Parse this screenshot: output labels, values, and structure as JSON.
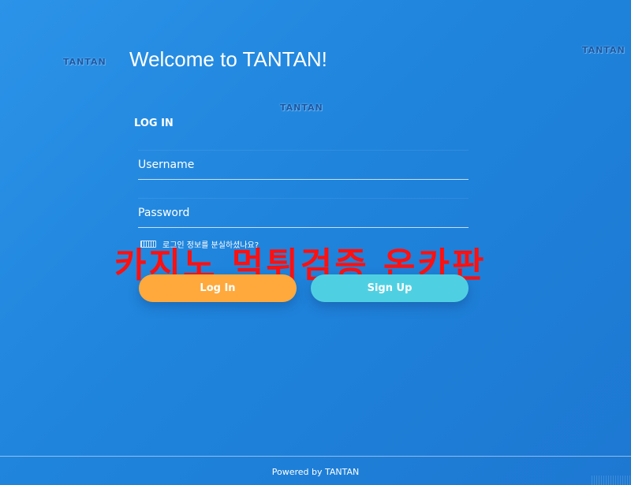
{
  "watermarks": [
    "TANTAN",
    "TANTAN",
    "TANTAN"
  ],
  "header": {
    "welcome_title": "Welcome to TANTAN!"
  },
  "login": {
    "heading": "LOG IN",
    "username_placeholder": "Username",
    "password_placeholder": "Password",
    "forgot_text": "로그인 정보를 분실하셨나요?",
    "forgot_icon": "keyboard-icon",
    "login_button": "Log In",
    "signup_button": "Sign Up"
  },
  "overlay": {
    "text": "카지노 먹튀검증 온카판"
  },
  "footer": {
    "text": "Powered by TANTAN"
  },
  "colors": {
    "background": "#2089e0",
    "login_button": "#ffa93c",
    "signup_button": "#4fd0e2",
    "overlay_text": "#ff1010"
  }
}
